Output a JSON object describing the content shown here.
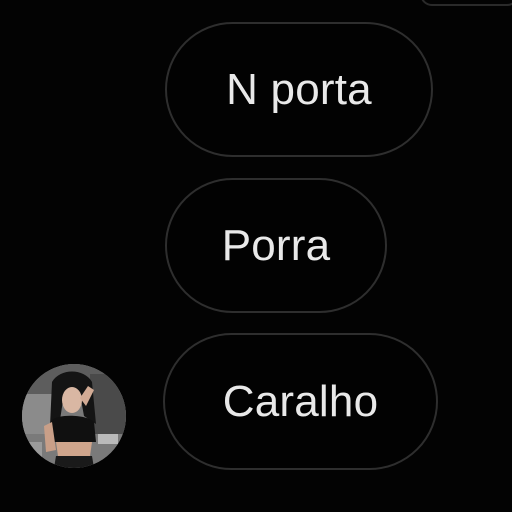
{
  "conversation": {
    "messages": [
      {
        "text": "N porta"
      },
      {
        "text": "Porra"
      },
      {
        "text": "Caralho"
      }
    ],
    "avatar_icon": "user-photo-avatar"
  },
  "colors": {
    "background": "#030303",
    "bubble_border": "#2e2e2e",
    "text": "#e9e9e9"
  }
}
